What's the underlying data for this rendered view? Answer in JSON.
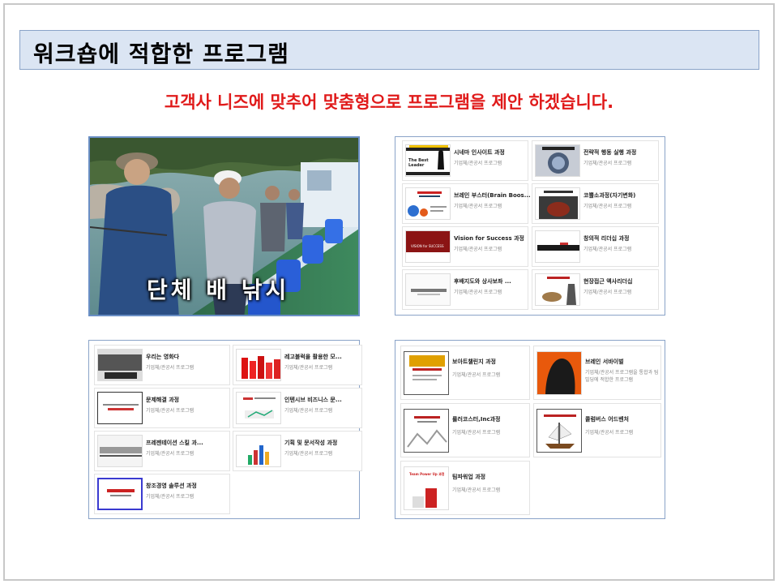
{
  "title": "워크숍에 적합한 프로그램",
  "subtitle": "고객사 니즈에 맞추어 맞춤형으로 프로그램을 제안 하겠습니다.",
  "photo": {
    "caption": "단체 배 낚시"
  },
  "panels": [
    {
      "cards": [
        {
          "title": "시네마 인사이트 과정",
          "sub": "기업체/관공서 프로그램",
          "thumb_text": "The Best Leader"
        },
        {
          "title": "전략적 행동 실행 과정",
          "sub": "기업체/관공서 프로그램",
          "thumb_text": ""
        },
        {
          "title": "브레인 부스터(Brain Boos...",
          "sub": "기업체/관공서 프로그램",
          "thumb_text": ""
        },
        {
          "title": "코뿔소과정(자기변화)",
          "sub": "기업체/관공서 프로그램",
          "thumb_text": ""
        },
        {
          "title": "Vision for Success 과정",
          "sub": "기업체/관공서 프로그램",
          "thumb_text": "VISION for SUCCESS"
        },
        {
          "title": "창의적 리더십 과정",
          "sub": "기업체/관공서 프로그램",
          "thumb_text": ""
        },
        {
          "title": "후배지도와 상사보좌 ...",
          "sub": "기업체/관공서 프로그램",
          "thumb_text": ""
        },
        {
          "title": "현장접근 액사리더십",
          "sub": "기업체/관공서 프로그램",
          "thumb_text": ""
        }
      ]
    },
    {
      "cards": [
        {
          "title": "우리는 영화다",
          "sub": "기업체/관공서 프로그램",
          "thumb_text": ""
        },
        {
          "title": "레고블럭을 활용한 모...",
          "sub": "기업체/관공서 프로그램",
          "thumb_text": ""
        },
        {
          "title": "문제해결 과정",
          "sub": "기업체/관공서 프로그램",
          "thumb_text": ""
        },
        {
          "title": "인텐시브 비즈니스 문...",
          "sub": "기업체/관공서 프로그램",
          "thumb_text": ""
        },
        {
          "title": "프레젠테이션 스킬 과...",
          "sub": "기업체/관공서 프로그램",
          "thumb_text": ""
        },
        {
          "title": "기획 및 문서작성 과정",
          "sub": "기업체/관공서 프로그램",
          "thumb_text": ""
        },
        {
          "title": "창조경영 솔루션 과정",
          "sub": "기업체/관공서 프로그램",
          "thumb_text": ""
        }
      ]
    },
    {
      "cards": [
        {
          "title": "보아트챌린지 과정",
          "sub": "기업체/관공서 프로그램",
          "thumb_text": ""
        },
        {
          "title": "브레인 서바이벌",
          "sub": "기업체/관공서 프로그램을 통합과 팀빌딩에 적합한 프로그램",
          "thumb_text": ""
        },
        {
          "title": "롤러코스터,Inc과정",
          "sub": "기업체/관공서 프로그램",
          "thumb_text": ""
        },
        {
          "title": "콜럼버스 어드벤처",
          "sub": "기업체/관공서 프로그램",
          "thumb_text": ""
        },
        {
          "title": "팀파워업 과정",
          "sub": "기업체/관공서 프로그램",
          "thumb_text": "Team Power Up 과정"
        }
      ]
    }
  ]
}
